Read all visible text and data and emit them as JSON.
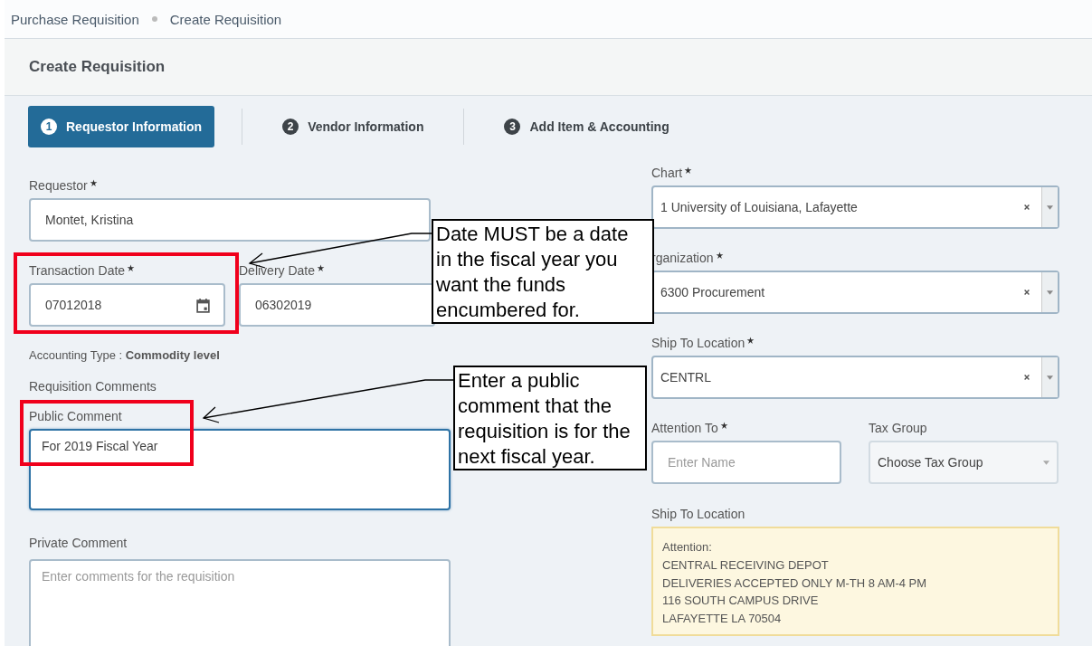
{
  "breadcrumb": [
    "Purchase Requisition",
    "Create Requisition"
  ],
  "page_title": "Create Requisition",
  "steps": [
    {
      "number": "1",
      "label": "Requestor Information",
      "selected": true
    },
    {
      "number": "2",
      "label": "Vendor Information",
      "selected": false
    },
    {
      "number": "3",
      "label": "Add Item & Accounting",
      "selected": false
    }
  ],
  "requestor": {
    "label": "Requestor",
    "required": true,
    "value": "Montet, Kristina"
  },
  "dates": [
    {
      "label": "Transaction Date",
      "required": true,
      "value": "07012018"
    },
    {
      "label": "Delivery Date",
      "required": true,
      "value": "06302019"
    }
  ],
  "accounting_type": "Accounting Type : **Commodity level**",
  "comments_heading": "Requisition Comments",
  "public_comment": {
    "label": "Public Comment",
    "value": "For 2019 Fiscal Year"
  },
  "private_comment": {
    "label": "Private Comment",
    "placeholder": "Enter comments for the requisition"
  },
  "selects": [
    {
      "label": "Chart",
      "required": true,
      "value": "1 University of Louisiana, Lafayette"
    },
    {
      "label": "rganization",
      "required": true,
      "value": "6300 Procurement"
    },
    {
      "label": "Ship To Location",
      "required": true,
      "value": "CENTRL"
    }
  ],
  "attention_to": {
    "label": "Attention To",
    "required": true,
    "placeholder": "Enter Name"
  },
  "tax_group": {
    "label": "Tax Group",
    "placeholder": "Choose Tax Group",
    "disabled": true
  },
  "ship_to_address": {
    "label": "Ship To Location",
    "lines": [
      "Attention:",
      "CENTRAL RECEIVING DEPOT",
      "DELIVERIES ACCEPTED ONLY M-TH 8 AM-4 PM",
      "116 SOUTH CAMPUS DRIVE",
      "LAFAYETTE LA 70504"
    ]
  },
  "annotations": [
    {
      "text": "Date MUST be a date in the fiscal year you want the funds encumbered for."
    },
    {
      "text": "Enter a public comment that the requisition is for the next fiscal year."
    }
  ]
}
